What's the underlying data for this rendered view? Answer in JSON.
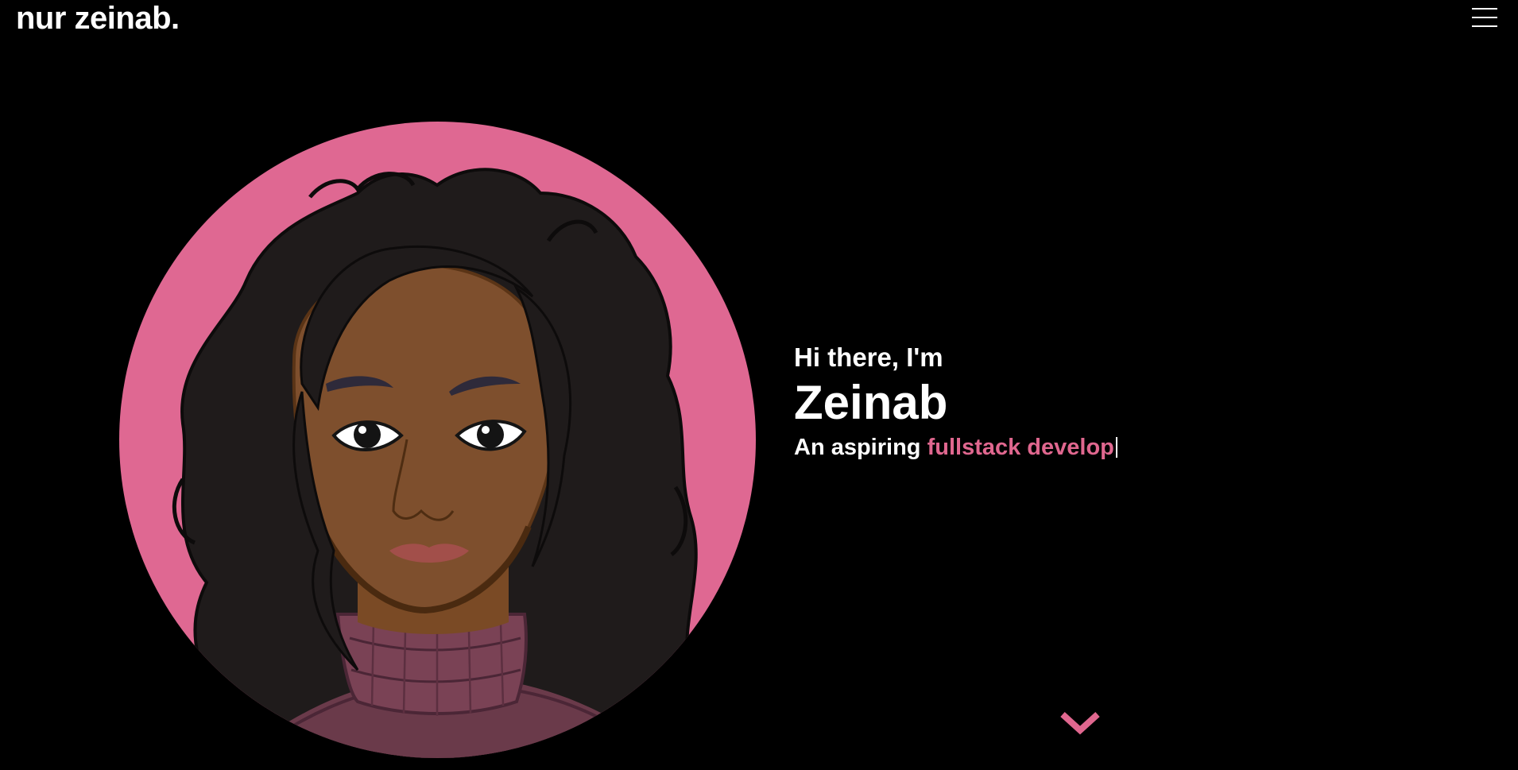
{
  "header": {
    "brand": "nur zeinab.",
    "menu_icon": "hamburger-menu-icon"
  },
  "hero": {
    "greeting": "Hi there, I'm",
    "name": "Zeinab",
    "tagline_prefix": "An aspiring",
    "tagline_typed": "fullstack develop",
    "avatar_icon": "avatar-illustration",
    "scroll_icon": "chevron-down-icon"
  },
  "colors": {
    "background": "#000000",
    "accent": "#e0678f",
    "avatar_bg": "#df6892",
    "text": "#ffffff"
  }
}
